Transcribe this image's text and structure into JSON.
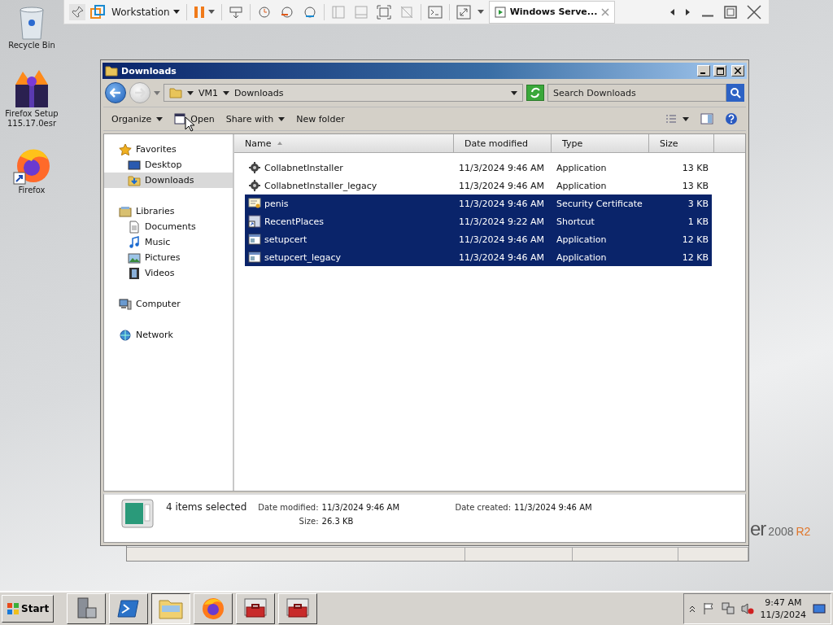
{
  "vm_toolbar": {
    "menu": "Workstation",
    "tab": {
      "title": "Windows Serve...",
      "selected": true
    }
  },
  "desktop_icons": [
    {
      "kind": "recycle-bin",
      "label": "Recycle Bin"
    },
    {
      "kind": "installer",
      "label": "Firefox Setup 115.17.0esr"
    },
    {
      "kind": "firefox",
      "label": "Firefox"
    }
  ],
  "branding": {
    "text": "er",
    "version": "2008",
    "edition": "R2"
  },
  "window": {
    "title": "Downloads",
    "breadcrumb": [
      "VM1",
      "Downloads"
    ],
    "search": {
      "placeholder": "Search Downloads"
    },
    "commands": [
      {
        "label": "Organize",
        "kind": "menu"
      },
      {
        "label": "Open",
        "kind": "open"
      },
      {
        "label": "Share with",
        "kind": "menu"
      },
      {
        "label": "New folder",
        "kind": "plain"
      }
    ],
    "nav": [
      {
        "label": "Favorites",
        "kind": "favorites",
        "selected": false,
        "children": [
          {
            "label": "Desktop",
            "kind": "desktop",
            "selected": false
          },
          {
            "label": "Downloads",
            "kind": "downloads",
            "selected": true
          }
        ]
      },
      {
        "label": "Libraries",
        "kind": "libraries",
        "selected": false,
        "children": [
          {
            "label": "Documents",
            "kind": "documents",
            "selected": false
          },
          {
            "label": "Music",
            "kind": "music",
            "selected": false
          },
          {
            "label": "Pictures",
            "kind": "pictures",
            "selected": false
          },
          {
            "label": "Videos",
            "kind": "videos",
            "selected": false
          }
        ]
      },
      {
        "label": "Computer",
        "kind": "computer",
        "selected": false
      },
      {
        "label": "Network",
        "kind": "network",
        "selected": false
      }
    ],
    "table": {
      "columns": [
        "Name",
        "Date modified",
        "Type",
        "Size"
      ],
      "rows": [
        {
          "kind": "installer",
          "name": "CollabnetInstaller",
          "date": "11/3/2024 9:46 AM",
          "type": "Application",
          "size": "13 KB",
          "selected": false
        },
        {
          "kind": "installer",
          "name": "CollabnetInstaller_legacy",
          "date": "11/3/2024 9:46 AM",
          "type": "Application",
          "size": "13 KB",
          "selected": false
        },
        {
          "kind": "certificate",
          "name": "penis",
          "date": "11/3/2024 9:46 AM",
          "type": "Security Certificate",
          "size": "3 KB",
          "selected": true
        },
        {
          "kind": "shortcut",
          "name": "RecentPlaces",
          "date": "11/3/2024 9:22 AM",
          "type": "Shortcut",
          "size": "1 KB",
          "selected": true
        },
        {
          "kind": "app",
          "name": "setupcert",
          "date": "11/3/2024 9:46 AM",
          "type": "Application",
          "size": "12 KB",
          "selected": true
        },
        {
          "kind": "app",
          "name": "setupcert_legacy",
          "date": "11/3/2024 9:46 AM",
          "type": "Application",
          "size": "12 KB",
          "selected": true
        }
      ]
    },
    "details": {
      "summary": "4 items selected",
      "fields": [
        {
          "label": "Date modified:",
          "value": "11/3/2024 9:46 AM"
        },
        {
          "label": "Date created:",
          "value": "11/3/2024 9:46 AM"
        },
        {
          "label": "Size:",
          "value": "26.3 KB"
        }
      ]
    }
  },
  "taskbar": {
    "start": "Start",
    "apps": [
      {
        "kind": "server-manager",
        "selected": false
      },
      {
        "kind": "powershell",
        "selected": false
      },
      {
        "kind": "explorer",
        "selected": true
      },
      {
        "kind": "firefox",
        "selected": false
      },
      {
        "kind": "toolbox",
        "selected": false
      },
      {
        "kind": "toolbox",
        "selected": false
      }
    ],
    "clock": {
      "time": "9:47 AM",
      "date": "11/3/2024"
    }
  }
}
